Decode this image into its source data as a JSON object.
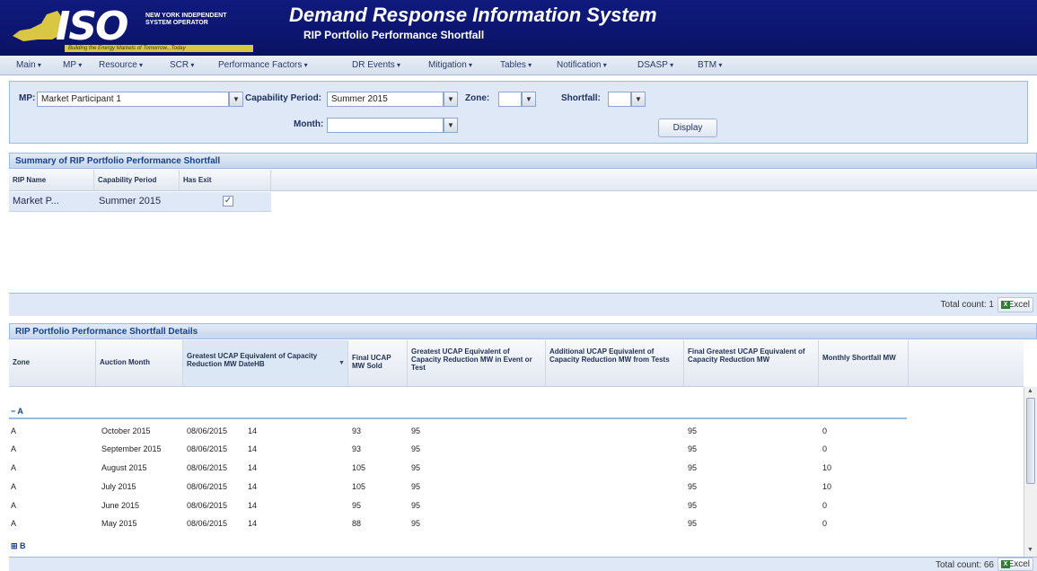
{
  "header": {
    "logo_text": "ISO",
    "org_name": "NEW YORK INDEPENDENT SYSTEM OPERATOR",
    "tagline": "Building the Energy Markets of Tomorrow...Today",
    "title": "Demand Response Information System",
    "subtitle": "RIP Portfolio Performance Shortfall"
  },
  "menu": [
    "Main",
    "MP",
    "Resource",
    "SCR",
    "Performance Factors",
    "DR Events",
    "Mitigation",
    "Tables",
    "Notification",
    "DSASP",
    "BTM"
  ],
  "filters": {
    "mp_label": "MP:",
    "mp_value": "Market Participant 1",
    "capability_label": "Capability Period:",
    "capability_value": "Summer 2015",
    "zone_label": "Zone:",
    "zone_value": "",
    "shortfall_label": "Shortfall:",
    "shortfall_value": "",
    "month_label": "Month:",
    "month_value": "",
    "display_button": "Display"
  },
  "summary": {
    "title": "Summary of RIP Portfolio Performance Shortfall",
    "columns": [
      "RIP Name",
      "Capability Period",
      "Has Exit"
    ],
    "row": {
      "rip_name": "Market P...",
      "capability_period": "Summer 2015",
      "has_exit_checked": true
    },
    "total_count": "Total count: 1",
    "excel_label": "Excel"
  },
  "details": {
    "title": "RIP Portfolio Performance Shortfall Details",
    "columns": [
      "Zone",
      "Auction Month",
      "Greatest UCAP Equivalent of Capacity Reduction MW DateHB",
      "Final UCAP MW Sold",
      "Greatest UCAP Equivalent of Capacity Reduction MW in Event or Test",
      "Additional UCAP Equivalent of Capacity Reduction MW from Tests",
      "Final Greatest UCAP Equivalent of Capacity Reduction MW",
      "Monthly Shortfall MW"
    ],
    "group_a": "− A",
    "group_b": "⊞ B",
    "rows": [
      {
        "zone": "A",
        "month": "October 2015",
        "date": "08/06/2015",
        "hb": "14",
        "ucap_sold": "93",
        "greatest_event": "95",
        "additional": "",
        "final_greatest": "95",
        "shortfall": "0"
      },
      {
        "zone": "A",
        "month": "September 2015",
        "date": "08/06/2015",
        "hb": "14",
        "ucap_sold": "93",
        "greatest_event": "95",
        "additional": "",
        "final_greatest": "95",
        "shortfall": "0"
      },
      {
        "zone": "A",
        "month": "August 2015",
        "date": "08/06/2015",
        "hb": "14",
        "ucap_sold": "105",
        "greatest_event": "95",
        "additional": "",
        "final_greatest": "95",
        "shortfall": "10"
      },
      {
        "zone": "A",
        "month": "July 2015",
        "date": "08/06/2015",
        "hb": "14",
        "ucap_sold": "105",
        "greatest_event": "95",
        "additional": "",
        "final_greatest": "95",
        "shortfall": "10"
      },
      {
        "zone": "A",
        "month": "June 2015",
        "date": "08/06/2015",
        "hb": "14",
        "ucap_sold": "95",
        "greatest_event": "95",
        "additional": "",
        "final_greatest": "95",
        "shortfall": "0"
      },
      {
        "zone": "A",
        "month": "May 2015",
        "date": "08/06/2015",
        "hb": "14",
        "ucap_sold": "88",
        "greatest_event": "95",
        "additional": "",
        "final_greatest": "95",
        "shortfall": "0"
      }
    ],
    "total_count": "Total count: 66",
    "excel_label": "Excel"
  },
  "colors": {
    "banner": "#0c1670",
    "panel": "#dfe8f6",
    "panel_border": "#99bbe8",
    "header_text": "#15428b"
  }
}
